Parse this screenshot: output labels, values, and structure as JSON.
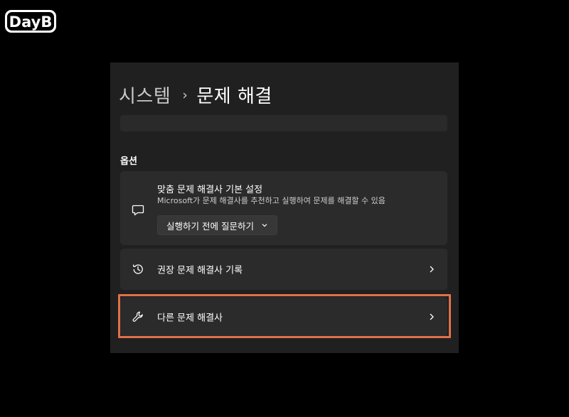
{
  "logo": {
    "text": "DayB"
  },
  "header": {
    "parent": "시스템",
    "separator": "›",
    "current": "문제 해결"
  },
  "section": {
    "title": "옵션"
  },
  "cards": {
    "custom": {
      "title": "맞춤 문제 해결사 기본 설정",
      "description": "Microsoft가 문제 해결사를 추천하고 실행하여 문제를 해결할 수 있음",
      "dropdown_value": "실행하기 전에 질문하기",
      "icon": "chat-bubble-icon"
    },
    "history": {
      "label": "권장 문제 해결사 기록",
      "icon": "history-icon"
    },
    "other": {
      "label": "다른 문제 해결사",
      "icon": "wrench-icon"
    }
  },
  "colors": {
    "background": "#000000",
    "panel": "#202020",
    "card": "#2b2b2b",
    "highlight": "#e0704a"
  }
}
